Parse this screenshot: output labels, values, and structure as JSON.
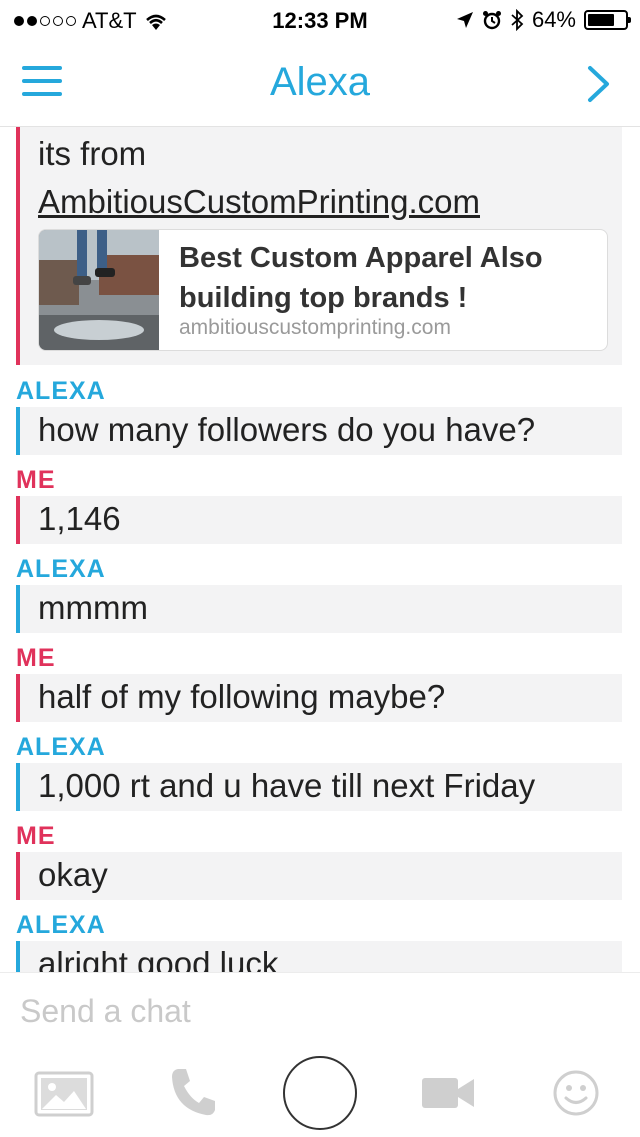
{
  "status_bar": {
    "carrier": "AT&T",
    "time": "12:33 PM",
    "battery": "64%",
    "battery_level": 0.64
  },
  "header": {
    "title": "Alexa",
    "menu_icon": "hamburger-icon",
    "forward_icon": "chevron-right-icon"
  },
  "messages": [
    {
      "sender": "",
      "lines": [
        "its from",
        "AmbitiousCustomPrinting.com"
      ],
      "link_card": {
        "title": "Best Custom Apparel Also building top brands !",
        "domain": "ambitiouscustomprinting.com"
      }
    },
    {
      "sender": "ALEXA",
      "text": "how many followers do you have?"
    },
    {
      "sender": "ME",
      "text": "1,146"
    },
    {
      "sender": "ALEXA",
      "text": "mmmm"
    },
    {
      "sender": "ME",
      "text": "half of my following maybe?"
    },
    {
      "sender": "ALEXA",
      "text": "1,000 rt and u have till next Friday"
    },
    {
      "sender": "ME",
      "text": "okay"
    },
    {
      "sender": "ALEXA",
      "text": "alright good luck"
    }
  ],
  "input": {
    "placeholder": "Send a chat"
  },
  "toolbar": {
    "icons": [
      "image-icon",
      "phone-icon",
      "capture-button",
      "video-camera-icon",
      "smiley-icon"
    ]
  },
  "colors": {
    "accent": "#25a8dc",
    "me": "#e0325b",
    "bubble": "#f3f3f4"
  }
}
